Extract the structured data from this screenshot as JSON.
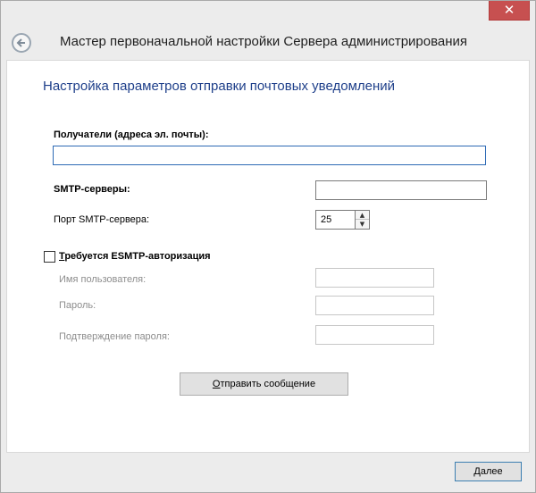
{
  "window": {
    "title": "Мастер первоначальной настройки Сервера администрирования",
    "close_glyph": "✕"
  },
  "page": {
    "heading": "Настройка параметров отправки почтовых уведомлений"
  },
  "form": {
    "recipients_label": "Получатели (адреса эл. почты):",
    "recipients_value": "",
    "smtp_servers_label": "SMTP-серверы:",
    "smtp_servers_value": "",
    "smtp_port_label": "Порт SMTP-сервера:",
    "smtp_port_value": "25",
    "spin_up_glyph": "▲",
    "spin_down_glyph": "▼",
    "esmtp_auth_label_first": "Т",
    "esmtp_auth_label_rest": "ребуется ESMTP-авторизация",
    "esmtp_auth_checked": false,
    "username_label": "Имя пользователя:",
    "username_value": "",
    "password_label": "Пароль:",
    "password_value": "",
    "confirm_password_label": "Подтверждение пароля:",
    "confirm_password_value": "",
    "send_button_first": "О",
    "send_button_rest": "тправить сообщение"
  },
  "footer": {
    "next_button_first": "Д",
    "next_button_rest": "алее"
  },
  "icons": {
    "back": "back-arrow-icon",
    "close": "close-icon"
  },
  "colors": {
    "heading": "#1e3f8a",
    "close_button": "#c75050",
    "focus_border": "#2d6ab5"
  }
}
